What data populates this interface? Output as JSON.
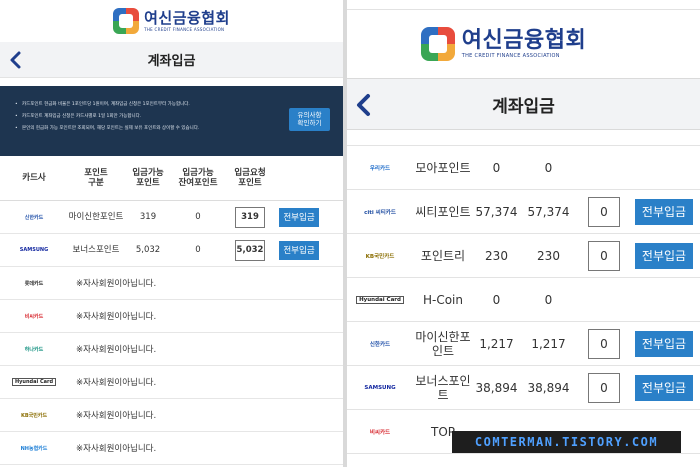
{
  "left": {
    "logo": {
      "name_ko": "여신금융협회",
      "name_en": "THE CREDIT FINANCE ASSOCIATION"
    },
    "title": "계좌입금",
    "notice": {
      "lines": [
        "카드포인트 현금화 비율은 1포인트당 1원이며, 계좌입금 신청은 1포인트부터 가능합니다.",
        "카드포인트 계좌입금 신청은 카드사별로 1일 1회만 가능합니다.",
        "본인의 현금화 가능 포인트만 조회되며, 해당 포인트는 실제 보유 포인트와 상이할 수 있습니다."
      ],
      "button": "유의사항\n확인하기"
    },
    "columns": [
      "카드사",
      "포인트\n구분",
      "입금가능\n포인트",
      "입금가능\n잔여포인트",
      "입금요청\n포인트"
    ],
    "rows": [
      {
        "card": "신한카드",
        "card_color": "#1f4fa8",
        "point_name": "마이신한포인트",
        "available": "319",
        "remaining": "0",
        "request": "319",
        "button": "전부입금"
      },
      {
        "card": "SAMSUNG",
        "card_color": "#1428a0",
        "point_name": "보너스포인트",
        "available": "5,032",
        "remaining": "0",
        "request": "5,032",
        "button": "전부입금"
      }
    ],
    "member_rows": [
      {
        "card": "롯데카드",
        "card_color": "#222222",
        "message": "※자사회원이아닙니다."
      },
      {
        "card": "비씨카드",
        "card_color": "#d7282f",
        "message": "※자사회원이아닙니다."
      },
      {
        "card": "하나카드",
        "card_color": "#0f8f7e",
        "message": "※자사회원이아닙니다."
      },
      {
        "card": "Hyundai Card",
        "card_color": "#222222",
        "message": "※자사회원이아닙니다."
      },
      {
        "card": "KB국민카드",
        "card_color": "#f5b400",
        "message": "※자사회원이아닙니다."
      },
      {
        "card": "NH농협카드",
        "card_color": "#1c7ed6",
        "message": "※자사회원이아닙니다."
      }
    ]
  },
  "right": {
    "logo": {
      "name_ko": "여신금융협회",
      "name_en": "THE CREDIT FINANCE ASSOCIATION"
    },
    "title": "계좌입금",
    "rows": [
      {
        "card": "우리카드",
        "card_color": "#1b6ac9",
        "point_name": "모아포인트",
        "available": "0",
        "remaining": "0"
      },
      {
        "card": "citi 씨티카드",
        "card_color": "#1b4aa0",
        "point_name": "씨티포인트",
        "available": "57,374",
        "remaining": "57,374",
        "request": "0",
        "button": "전부입금"
      },
      {
        "card": "KB국민카드",
        "card_color": "#f5b400",
        "point_name": "포인트리",
        "available": "230",
        "remaining": "230",
        "request": "0",
        "button": "전부입금"
      },
      {
        "card": "Hyundai Card",
        "card_color": "#222222",
        "point_name": "H-Coin",
        "available": "0",
        "remaining": "0"
      },
      {
        "card": "신한카드",
        "card_color": "#1f4fa8",
        "point_name": "마이신한포인트",
        "available": "1,217",
        "remaining": "1,217",
        "request": "0",
        "button": "전부입금"
      },
      {
        "card": "SAMSUNG",
        "card_color": "#1428a0",
        "point_name": "보너스포인트",
        "available": "38,894",
        "remaining": "38,894",
        "request": "0",
        "button": "전부입금"
      },
      {
        "card": "비씨카드",
        "card_color": "#d7282f",
        "point_name": "TOP"
      }
    ]
  },
  "watermark": "COMTERMAN.TISTORY.COM",
  "colors": {
    "accent": "#2a80c8",
    "notice_bg": "#1e3550"
  }
}
